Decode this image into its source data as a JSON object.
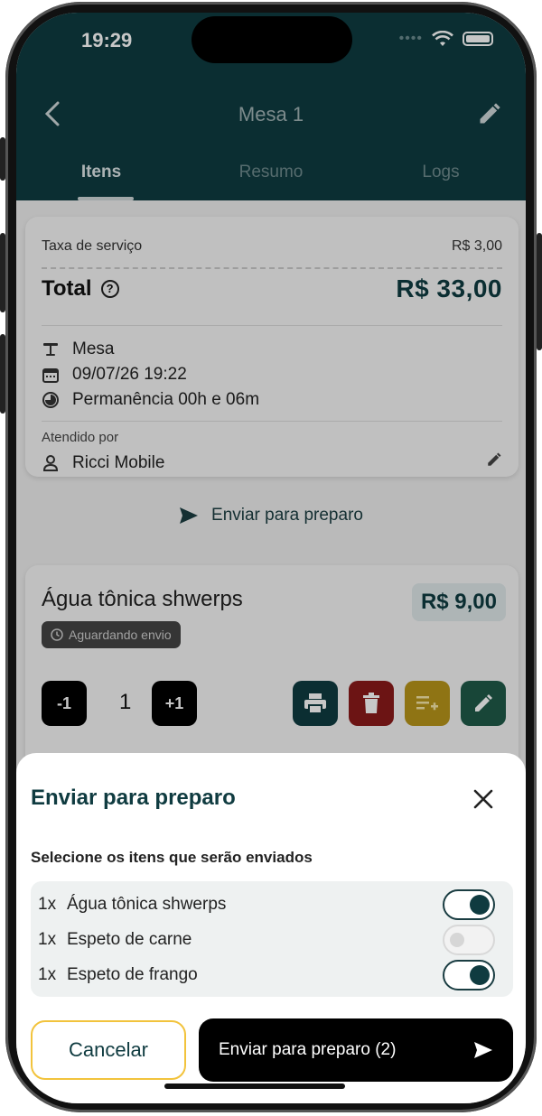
{
  "status_bar": {
    "time": "19:29"
  },
  "header": {
    "title": "Mesa 1"
  },
  "tabs": [
    {
      "label": "Itens",
      "active": true
    },
    {
      "label": "Resumo",
      "active": false
    },
    {
      "label": "Logs",
      "active": false
    }
  ],
  "summary": {
    "service_fee_label": "Taxa de serviço",
    "service_fee_value": "R$ 3,00",
    "total_label": "Total",
    "total_value": "R$ 33,00",
    "table_label": "Mesa",
    "date": "09/07/26 19:22",
    "stay": "Permanência 00h e 06m",
    "served_by_label": "Atendido por",
    "served_by_name": "Ricci Mobile"
  },
  "send_link": "Enviar para preparo",
  "item_card": {
    "name": "Água tônica shwerps",
    "price": "R$ 9,00",
    "status": "Aguardando envio",
    "minus": "-1",
    "qty": "1",
    "plus": "+1"
  },
  "sheet": {
    "title": "Enviar para preparo",
    "subtitle": "Selecione os itens que serão enviados",
    "items": [
      {
        "qty": "1x",
        "name": "Água tônica shwerps",
        "selected": true
      },
      {
        "qty": "1x",
        "name": "Espeto de carne",
        "selected": false
      },
      {
        "qty": "1x",
        "name": "Espeto de frango",
        "selected": true
      }
    ],
    "cancel": "Cancelar",
    "confirm": "Enviar para preparo (2)"
  },
  "colors": {
    "primary": "#0f3b40",
    "accent_yellow": "#f2c33c",
    "danger": "#8b1a1a",
    "success": "#1f5a48"
  }
}
